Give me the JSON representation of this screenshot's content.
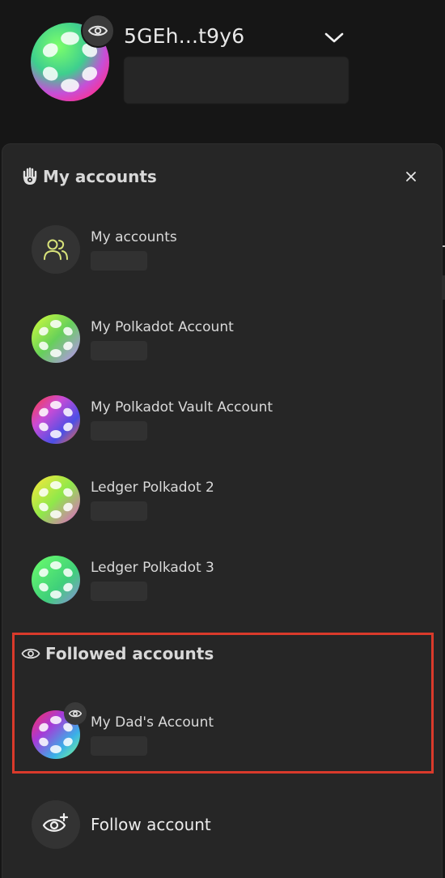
{
  "header": {
    "address": "5GEh...t9y6",
    "watch_icon": "eye-icon",
    "dropdown_icon": "chevron-down-icon"
  },
  "panel": {
    "title": "My accounts",
    "title_icon": "hamsa-hand-icon",
    "close_icon": "close-icon",
    "accounts": [
      {
        "name": "My accounts",
        "icon": "users-icon"
      },
      {
        "name": "My Polkadot Account",
        "icon": "polkadot-identicon"
      },
      {
        "name": "My Polkadot Vault Account",
        "icon": "polkadot-identicon"
      },
      {
        "name": "Ledger Polkadot 2",
        "icon": "polkadot-identicon"
      },
      {
        "name": "Ledger Polkadot 3",
        "icon": "polkadot-identicon"
      }
    ],
    "followed": {
      "title": "Followed accounts",
      "title_icon": "eye-icon",
      "accounts": [
        {
          "name": "My Dad's Account",
          "icon": "polkadot-identicon"
        }
      ]
    },
    "follow_action": {
      "label": "Follow account",
      "icon": "eye-plus-icon"
    }
  },
  "colors": {
    "background": "#161616",
    "panel": "#262626",
    "highlight_border": "#d93a2b",
    "users_icon": "#d8e27a"
  }
}
